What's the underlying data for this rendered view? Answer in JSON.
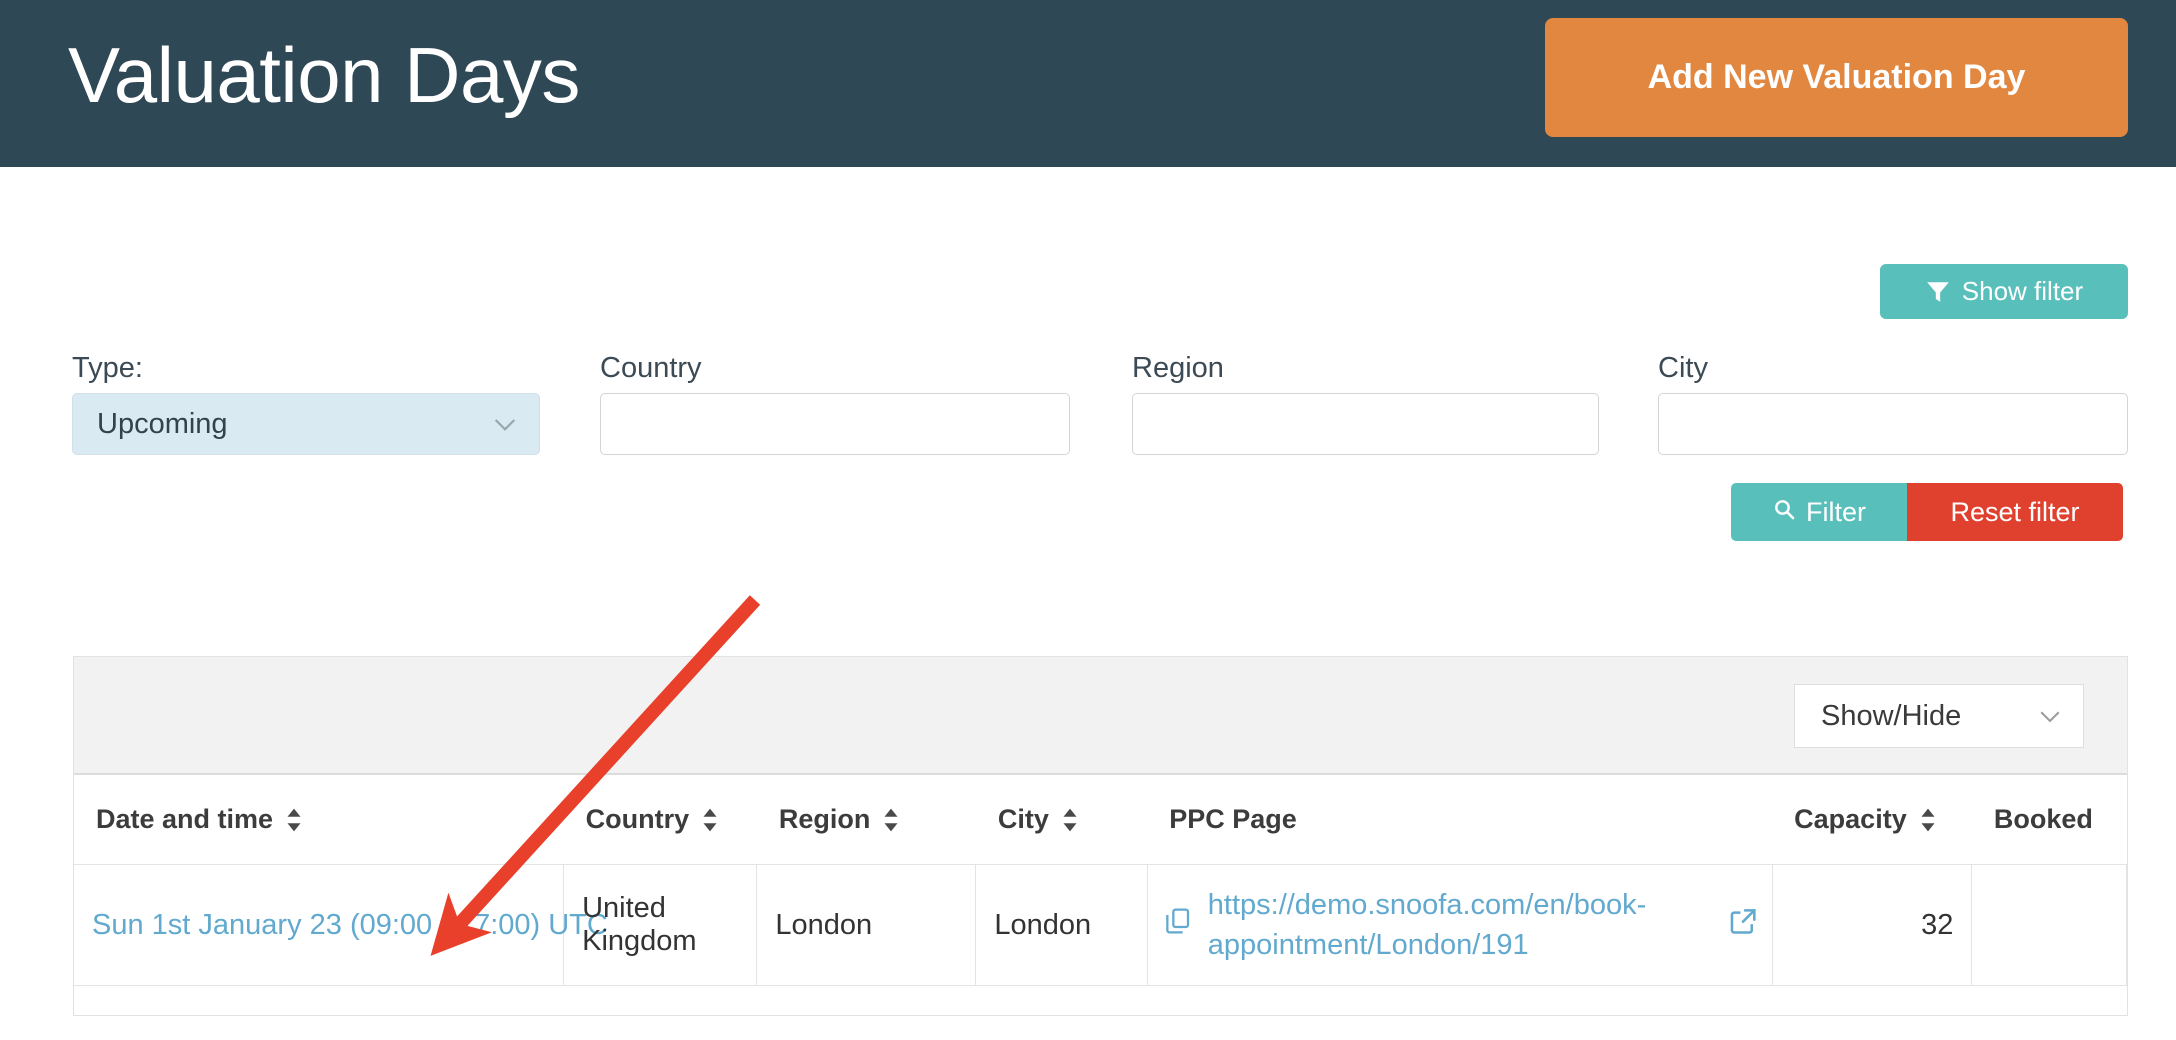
{
  "header": {
    "title": "Valuation Days",
    "add_button_label": "Add New Valuation Day",
    "bg_color": "#2F4855",
    "add_button_color": "#E28740"
  },
  "toolbar": {
    "show_filter_label": "Show filter",
    "show_filter_icon": "funnel-icon",
    "show_filter_color": "#58BFBA"
  },
  "filters": {
    "type": {
      "label": "Type:",
      "value": "Upcoming",
      "icon": "chevron-down-icon"
    },
    "country": {
      "label": "Country",
      "value": "",
      "placeholder": ""
    },
    "region": {
      "label": "Region",
      "value": "",
      "placeholder": ""
    },
    "city": {
      "label": "City",
      "value": "",
      "placeholder": ""
    },
    "actions": {
      "filter_label": "Filter",
      "filter_icon": "search-icon",
      "filter_color": "#58BFBA",
      "reset_label": "Reset filter",
      "reset_color": "#E0412F"
    }
  },
  "table": {
    "show_hide_label": "Show/Hide",
    "show_hide_icon": "chevron-down-icon",
    "columns": [
      {
        "label": "Date and time",
        "sortable": true
      },
      {
        "label": "Country",
        "sortable": true
      },
      {
        "label": "Region",
        "sortable": true
      },
      {
        "label": "City",
        "sortable": true
      },
      {
        "label": "PPC Page",
        "sortable": false
      },
      {
        "label": "Capacity",
        "sortable": true
      },
      {
        "label": "Booked",
        "sortable": false
      }
    ],
    "rows": [
      {
        "date_and_time": "Sun 1st January 23 (09:00 - 17:00) UTC",
        "country": "United Kingdom",
        "region": "London",
        "city": "London",
        "ppc_page_url": "https://demo.snoofa.com/en/book-appointment/London/191",
        "ppc_copy_icon": "copy-icon",
        "ppc_external_icon": "external-link-icon",
        "capacity": "32",
        "booked": ""
      }
    ],
    "link_color": "#61A9CE"
  },
  "annotation": {
    "arrow_color": "#E8402A",
    "arrow_name": "red-pointer-arrow"
  }
}
